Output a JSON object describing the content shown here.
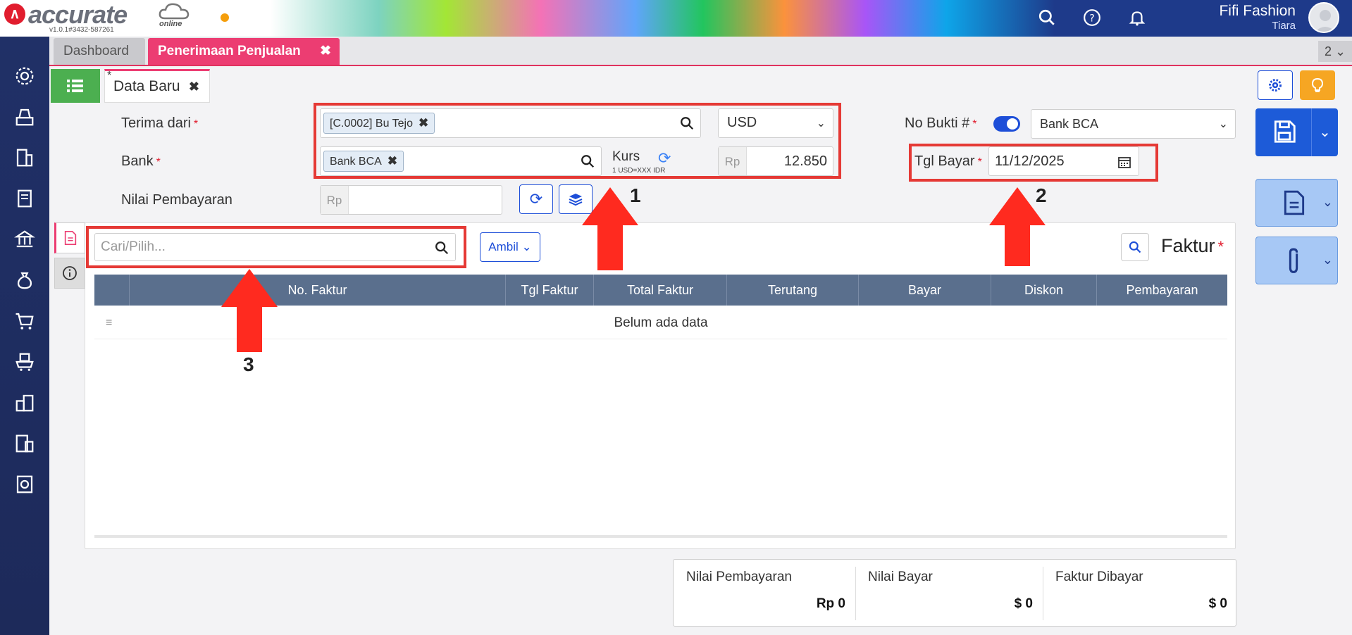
{
  "app": {
    "logo_text": "accurate",
    "logo_online": "online",
    "version": "v1.0.1#3432-587261",
    "company": "Fifi Fashion",
    "user": "Tiara"
  },
  "tabs": {
    "dashboard": "Dashboard",
    "active": "Penerimaan Penjualan",
    "count": "2 ⌄"
  },
  "subtab": {
    "star": "*",
    "label": "Data Baru"
  },
  "form": {
    "terima_dari_label": "Terima dari",
    "customer_chip": "[C.0002] Bu Tejo",
    "currency": "USD",
    "bank_label": "Bank",
    "bank_chip": "Bank BCA",
    "kurs_label": "Kurs",
    "kurs_note": "1 USD=XXX IDR",
    "kurs_prefix": "Rp",
    "kurs_value": "12.850",
    "nilai_label": "Nilai Pembayaran",
    "nilai_prefix": "Rp",
    "nilai_value": "",
    "no_bukti_label": "No Bukti #",
    "no_bukti_value": "Bank BCA",
    "tgl_label": "Tgl Bayar",
    "tgl_value": "11/12/2025",
    "required": "*"
  },
  "invoice": {
    "search_placeholder": "Cari/Pilih...",
    "ambil_label": "Ambil",
    "title": "Faktur",
    "columns": [
      "No. Faktur",
      "Tgl Faktur",
      "Total Faktur",
      "Terutang",
      "Bayar",
      "Diskon",
      "Pembayaran"
    ],
    "empty": "Belum ada data"
  },
  "summary": {
    "nilai_pembayaran_label": "Nilai Pembayaran",
    "nilai_pembayaran_value": "Rp 0",
    "nilai_bayar_label": "Nilai Bayar",
    "nilai_bayar_value": "$ 0",
    "faktur_dibayar_label": "Faktur Dibayar",
    "faktur_dibayar_value": "$ 0"
  },
  "annotations": {
    "a1": "1",
    "a2": "2",
    "a3": "3"
  },
  "colors": {
    "accent_pink": "#ec3d72",
    "primary_blue": "#1d5bd8",
    "annotation_red": "#e53935",
    "sidebar": "#1d2a5a"
  }
}
